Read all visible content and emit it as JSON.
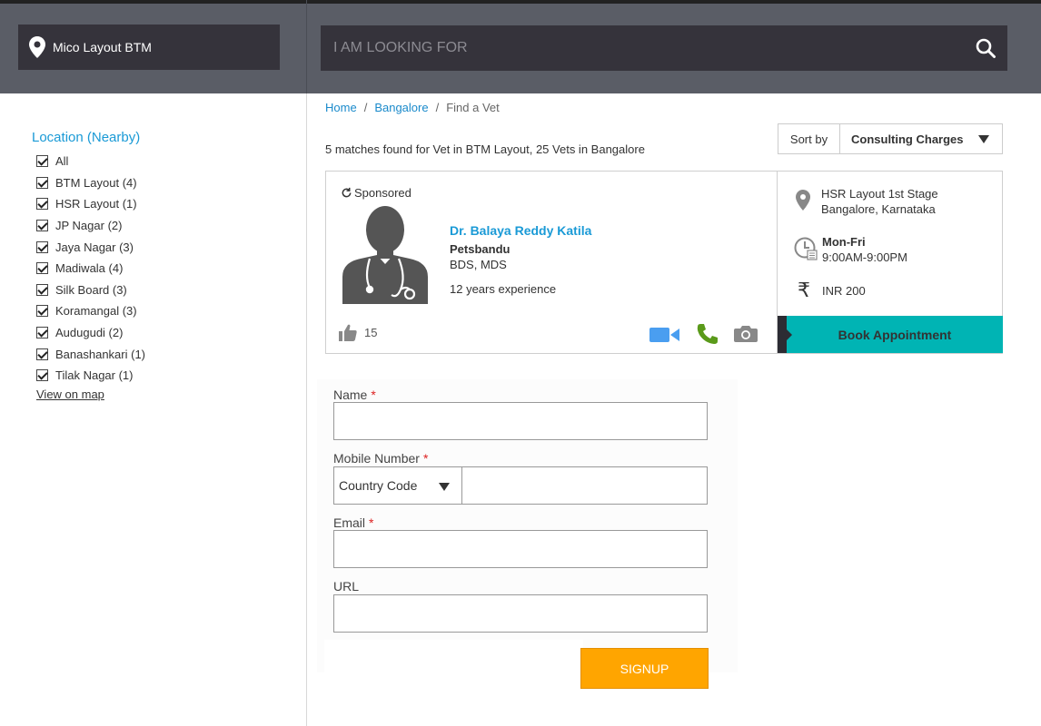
{
  "header": {
    "location": "Mico Layout BTM",
    "search_placeholder": "I AM LOOKING FOR",
    "icons": {
      "location": "pin-icon",
      "search": "search-icon"
    }
  },
  "sidebar": {
    "title": "Location",
    "title_suffix": "(Nearby)",
    "items": [
      {
        "label": "All",
        "checked": true
      },
      {
        "label": "BTM Layout (4)",
        "checked": true
      },
      {
        "label": "HSR Layout (1)",
        "checked": true
      },
      {
        "label": "JP Nagar (2)",
        "checked": true
      },
      {
        "label": "Jaya Nagar (3)",
        "checked": true
      },
      {
        "label": "Madiwala (4)",
        "checked": true
      },
      {
        "label": "Silk Board (3)",
        "checked": true
      },
      {
        "label": "Koramangal (3)",
        "checked": true
      },
      {
        "label": "Audugudi (2)",
        "checked": true
      },
      {
        "label": "Banashankari (1)",
        "checked": true
      },
      {
        "label": "Tilak Nagar (1)",
        "checked": true
      }
    ],
    "view_map": "View on map"
  },
  "breadcrumb": {
    "home": "Home",
    "city": "Bangalore",
    "current": "Find a Vet",
    "separator": "/"
  },
  "results": {
    "summary": "5 matches found for Vet in BTM Layout, 25 Vets in Bangalore",
    "sort_label": "Sort by",
    "sort_value": "Consulting Charges"
  },
  "card": {
    "sponsored": "Sponsored",
    "doctor_name": "Dr. Balaya Reddy Katila",
    "clinic": "Petsbandu",
    "degree": "BDS, MDS",
    "experience": "12 years experience",
    "likes": "15",
    "address_line1": "HSR Layout 1st Stage",
    "address_line2": "Bangalore, Karnataka",
    "days": "Mon-Fri",
    "hours": "9:00AM-9:00PM",
    "fee": "INR 200",
    "rupee_symbol": "₹",
    "book_label": "Book Appointment",
    "colors": {
      "accent": "#1a9ad6",
      "book": "#00b4b4",
      "phone": "#5a9a1a",
      "video": "#4a9ef0"
    }
  },
  "form": {
    "name_label": "Name",
    "mobile_label": "Mobile Number",
    "country_code": "Country Code",
    "email_label": "Email",
    "url_label": "URL",
    "required_mark": "*",
    "signup_label": "SIGNUP"
  }
}
